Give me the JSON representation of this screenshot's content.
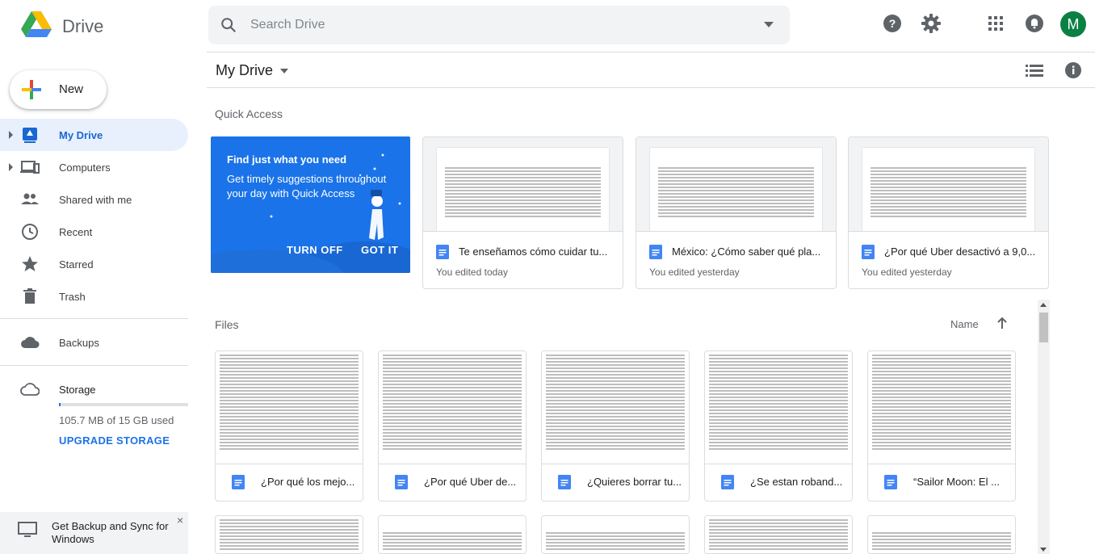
{
  "app": {
    "brand": "Drive"
  },
  "search": {
    "placeholder": "Search Drive"
  },
  "header": {
    "avatar_letter": "M"
  },
  "sidebar": {
    "new_label": "New",
    "items": [
      {
        "label": "My Drive",
        "icon": "my-drive-icon"
      },
      {
        "label": "Computers",
        "icon": "computers-icon"
      },
      {
        "label": "Shared with me",
        "icon": "shared-icon"
      },
      {
        "label": "Recent",
        "icon": "clock-icon"
      },
      {
        "label": "Starred",
        "icon": "star-icon"
      },
      {
        "label": "Trash",
        "icon": "trash-icon"
      }
    ],
    "backups_label": "Backups",
    "storage_label": "Storage",
    "storage_used": "105.7 MB of 15 GB used",
    "storage_fraction": 0.007,
    "upgrade_label": "UPGRADE STORAGE",
    "backup_promo": "Get Backup and Sync for Windows",
    "backup_close": "×"
  },
  "main": {
    "title": "My Drive",
    "quick_access_label": "Quick Access",
    "promo": {
      "title": "Find just what you need",
      "desc": "Get timely suggestions throughout your day with Quick Access",
      "turn_off": "TURN OFF",
      "got_it": "GOT IT"
    },
    "quick_access": [
      {
        "name": "Te enseñamos cómo cuidar tu...",
        "sub": "You edited today"
      },
      {
        "name": "México: ¿Cómo saber qué pla...",
        "sub": "You edited yesterday"
      },
      {
        "name": "¿Por qué Uber desactivó a 9,0...",
        "sub": "You edited yesterday"
      }
    ],
    "files_label": "Files",
    "sort_label": "Name",
    "files": [
      {
        "name": "¿Por qué los mejo..."
      },
      {
        "name": "¿Por qué Uber de..."
      },
      {
        "name": "¿Quieres borrar tu..."
      },
      {
        "name": "¿Se estan roband..."
      },
      {
        "name": "“Sailor Moon: El ..."
      }
    ]
  },
  "colors": {
    "accent": "#1a73e8",
    "active_bg": "#e8f0fe",
    "doc_blue": "#4285f4",
    "avatar": "#0b8043"
  }
}
